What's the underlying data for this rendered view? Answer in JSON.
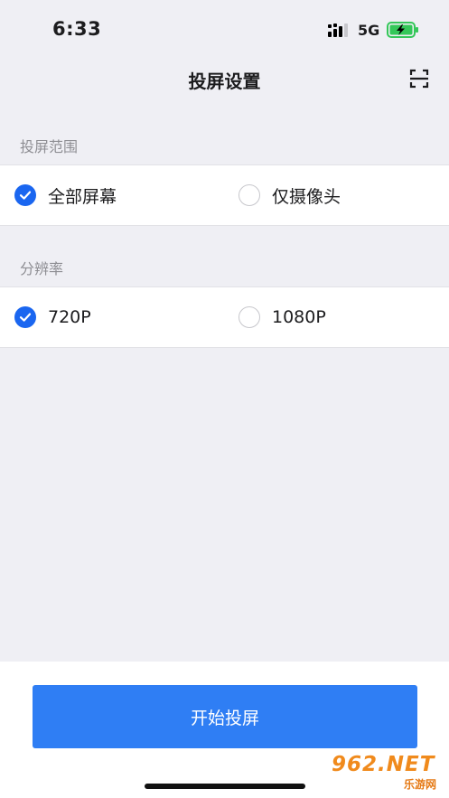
{
  "status_bar": {
    "time": "6:33",
    "network": "5G",
    "icons": [
      "signal-icon",
      "battery-charging-icon"
    ]
  },
  "nav": {
    "title": "投屏设置",
    "right_icon": "scan-icon"
  },
  "screen_range": {
    "header": "投屏范围",
    "options": [
      {
        "label": "全部屏幕",
        "selected": true
      },
      {
        "label": "仅摄像头",
        "selected": false
      }
    ]
  },
  "resolution": {
    "header": "分辨率",
    "options": [
      {
        "label": "720P",
        "selected": true
      },
      {
        "label": "1080P",
        "selected": false
      }
    ]
  },
  "actions": {
    "start_label": "开始投屏"
  },
  "watermark": {
    "main": "962.NET",
    "sub": "乐游网"
  },
  "colors": {
    "accent": "#1a66f0",
    "button": "#2f7ef4",
    "background": "#efeff4",
    "watermark": "#f08a1c"
  }
}
